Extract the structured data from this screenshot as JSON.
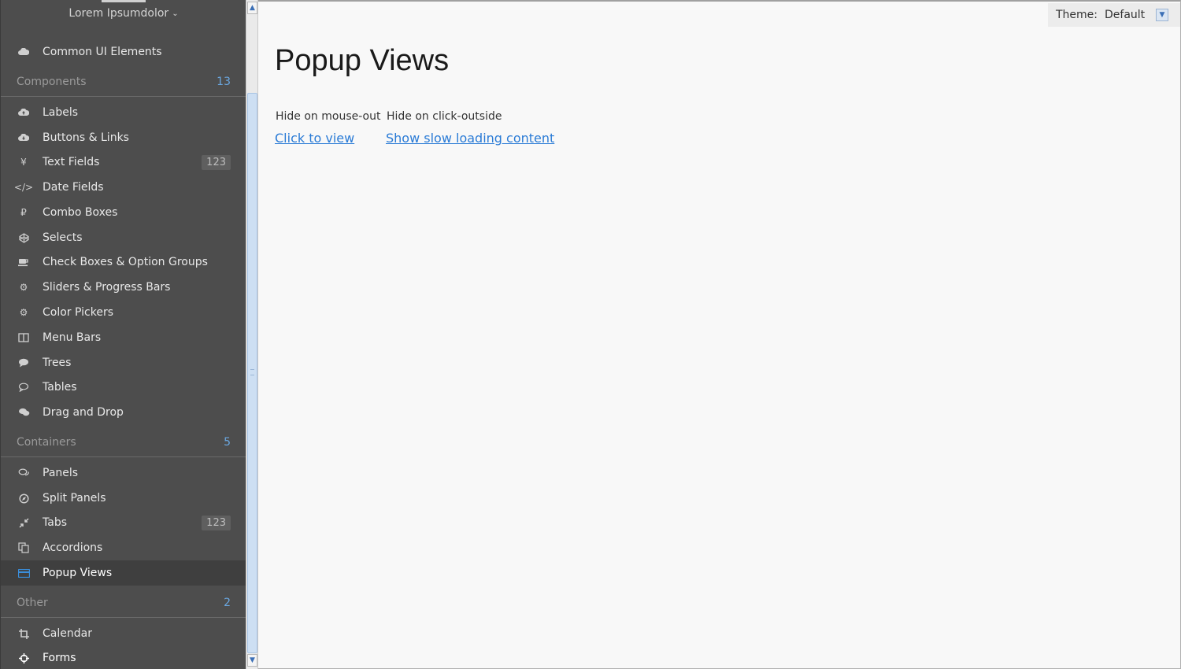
{
  "sidebar": {
    "user_menu": "Lorem Ipsumdolor",
    "top_item": "Common UI Elements",
    "sections": [
      {
        "label": "Components",
        "count": "13"
      },
      {
        "label": "Containers",
        "count": "5"
      },
      {
        "label": "Other",
        "count": "2"
      }
    ],
    "components": [
      {
        "label": "Labels",
        "icon": "cloud-upload-icon"
      },
      {
        "label": "Buttons & Links",
        "icon": "cloud-download-icon"
      },
      {
        "label": "Text Fields",
        "icon": "yen-icon",
        "badge": "123"
      },
      {
        "label": "Date Fields",
        "icon": "code-icon"
      },
      {
        "label": "Combo Boxes",
        "icon": "ruble-icon"
      },
      {
        "label": "Selects",
        "icon": "codepen-icon"
      },
      {
        "label": "Check Boxes & Option Groups",
        "icon": "coffee-icon"
      },
      {
        "label": "Sliders & Progress Bars",
        "icon": "cog-icon"
      },
      {
        "label": "Color Pickers",
        "icon": "cogs-icon"
      },
      {
        "label": "Menu Bars",
        "icon": "columns-icon"
      },
      {
        "label": "Trees",
        "icon": "comment-icon"
      },
      {
        "label": "Tables",
        "icon": "comment-outline-icon"
      },
      {
        "label": "Drag and Drop",
        "icon": "comments-icon"
      }
    ],
    "containers": [
      {
        "label": "Panels",
        "icon": "comments-outline-icon"
      },
      {
        "label": "Split Panels",
        "icon": "compass-icon"
      },
      {
        "label": "Tabs",
        "icon": "compress-icon",
        "badge": "123"
      },
      {
        "label": "Accordions",
        "icon": "copy-icon"
      },
      {
        "label": "Popup Views",
        "icon": "credit-card-icon",
        "active": true
      }
    ],
    "other": [
      {
        "label": "Calendar",
        "icon": "crop-icon"
      },
      {
        "label": "Forms",
        "icon": "crosshairs-icon"
      }
    ]
  },
  "theme": {
    "label": "Theme:",
    "value": "Default"
  },
  "main": {
    "title": "Popup Views",
    "columns": [
      {
        "label": "Hide on mouse-out",
        "link": "Click to view"
      },
      {
        "label": "Hide on click-outside",
        "link": "Show slow loading content"
      }
    ]
  },
  "colors": {
    "sidebar_bg": "#4d4d4d",
    "accent": "#3a8edb",
    "link": "#2a7bd6"
  }
}
